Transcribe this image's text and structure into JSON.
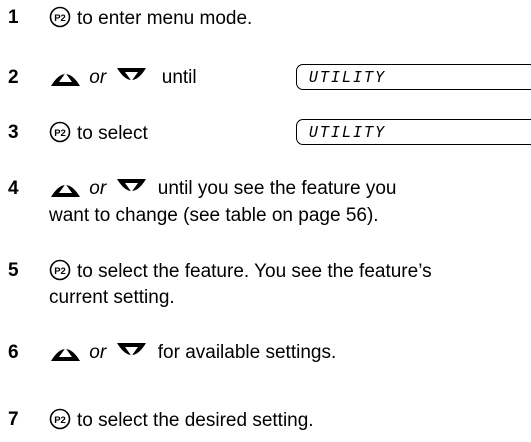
{
  "steps": [
    {
      "num": "1",
      "text": "to enter menu mode."
    },
    {
      "num": "2",
      "or": "or",
      "text": "until",
      "display": "UTILITY"
    },
    {
      "num": "3",
      "text": "to select",
      "display": "UTILITY"
    },
    {
      "num": "4",
      "or": "or",
      "text_line1": "until you see the feature you",
      "text_line2": "want to change (see table on page 56)."
    },
    {
      "num": "5",
      "text_line1": "to select the feature. You see the feature’s",
      "text_line2": "current setting."
    },
    {
      "num": "6",
      "or": "or",
      "text": "for available settings."
    },
    {
      "num": "7",
      "text": "to select the desired setting."
    }
  ],
  "icons": {
    "p2_button": "p2-button-icon",
    "up_arrow": "up-arrow-button-icon",
    "down_arrow": "down-arrow-button-icon"
  }
}
